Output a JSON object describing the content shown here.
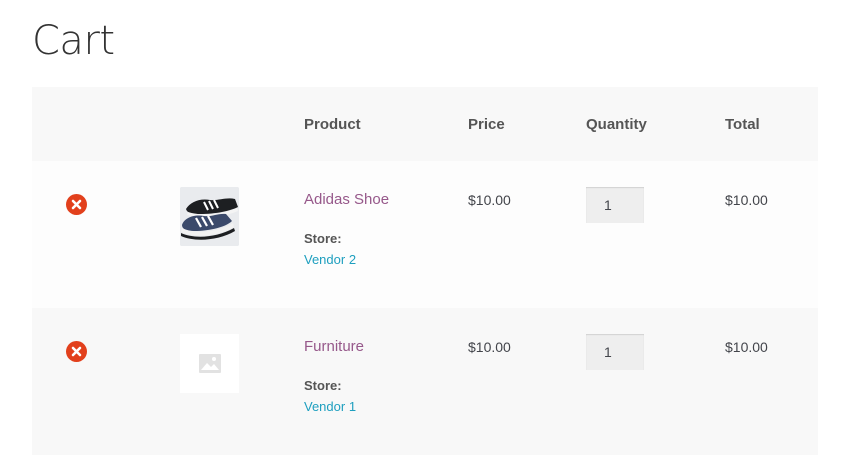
{
  "page": {
    "title": "Cart"
  },
  "table": {
    "headers": {
      "product": "Product",
      "price": "Price",
      "quantity": "Quantity",
      "total": "Total"
    }
  },
  "items": [
    {
      "name": "Adidas Shoe",
      "store_label": "Store:",
      "vendor": "Vendor 2",
      "price": "$10.00",
      "quantity": "1",
      "total": "$10.00",
      "thumbnail": "shoe-photo"
    },
    {
      "name": "Furniture",
      "store_label": "Store:",
      "vendor": "Vendor 1",
      "price": "$10.00",
      "quantity": "1",
      "total": "$10.00",
      "thumbnail": "image-placeholder-icon"
    }
  ],
  "colors": {
    "remove": "#e2401c",
    "product_link": "#96588a",
    "vendor_link": "#1e9fbf",
    "header_bg": "#f8f8f8"
  }
}
